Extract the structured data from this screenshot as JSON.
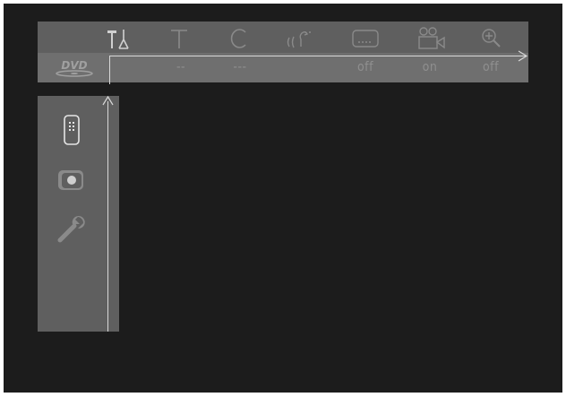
{
  "menu": {
    "items": [
      {
        "icon": "tools-icon",
        "value": ""
      },
      {
        "icon": "title-icon",
        "value": "--"
      },
      {
        "icon": "chapter-icon",
        "value": "---"
      },
      {
        "icon": "audio-icon",
        "value": ""
      },
      {
        "icon": "subtitle-icon",
        "value": "off"
      },
      {
        "icon": "camera-angle-icon",
        "value": "on"
      },
      {
        "icon": "zoom-icon",
        "value": "off"
      }
    ],
    "disc_logo": "DVD"
  },
  "sidebar": {
    "items": [
      {
        "icon": "remote-control-icon"
      },
      {
        "icon": "screen-display-icon"
      },
      {
        "icon": "wrench-icon"
      }
    ]
  },
  "colors": {
    "background": "#1c1c1c",
    "menubar": "#5f5f5f",
    "value_row": "#6f6f6f",
    "icon": "#8a8a8a",
    "selected_icon": "#e6e6e6",
    "line": "#d8d8d8"
  }
}
